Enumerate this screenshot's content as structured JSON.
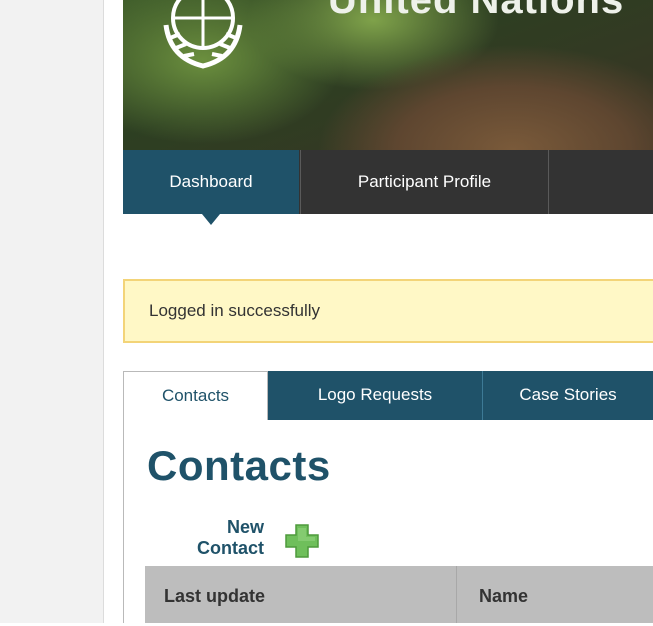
{
  "banner": {
    "title": "United Nations",
    "emblem_icon": "un-emblem-icon"
  },
  "nav": {
    "tabs": [
      {
        "label": "Dashboard",
        "active": true
      },
      {
        "label": "Participant Profile",
        "active": false
      }
    ]
  },
  "flash": {
    "message": "Logged in successfully"
  },
  "content_tabs": [
    {
      "label": "Contacts",
      "active": true
    },
    {
      "label": "Logo Requests",
      "active": false
    },
    {
      "label": "Case Stories",
      "active": false
    }
  ],
  "main": {
    "heading": "Contacts",
    "new_contact_label": "New Contact",
    "new_contact_icon": "plus-icon"
  },
  "table": {
    "columns": [
      "Last update",
      "Name"
    ]
  },
  "colors": {
    "primary": "#1f5269",
    "nav_bg": "#333333",
    "flash_bg": "#fff8c6",
    "flash_border": "#f3d478",
    "table_header_bg": "#bdbdbd",
    "plus_icon": "#6fbf5b"
  }
}
